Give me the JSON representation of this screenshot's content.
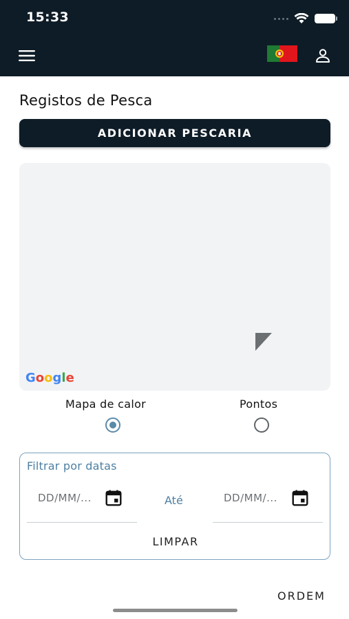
{
  "status_bar": {
    "time": "15:33"
  },
  "header": {
    "menu_icon": "menu-icon",
    "language_flag": "portugal-flag-icon",
    "user_icon": "user-icon"
  },
  "page": {
    "title": "Registos de Pesca",
    "add_button_label": "ADICIONAR PESCARIA"
  },
  "map": {
    "logo_letters": [
      "G",
      "o",
      "o",
      "g",
      "l",
      "e"
    ]
  },
  "view_options": [
    {
      "label": "Mapa de calor",
      "selected": true
    },
    {
      "label": "Pontos",
      "selected": false
    }
  ],
  "filter": {
    "legend": "Filtrar por datas",
    "from_placeholder": "DD/MM/...",
    "separator": "Até",
    "to_placeholder": "DD/MM/...",
    "clear_label": "LIMPAR"
  },
  "footer": {
    "order_label": "ORDEM"
  },
  "colors": {
    "header_bg": "#0e1c27",
    "accent": "#5b8aa8",
    "map_bg": "#f2f3f5",
    "portugal_green": "#1f7a33",
    "portugal_red": "#e0161c"
  }
}
